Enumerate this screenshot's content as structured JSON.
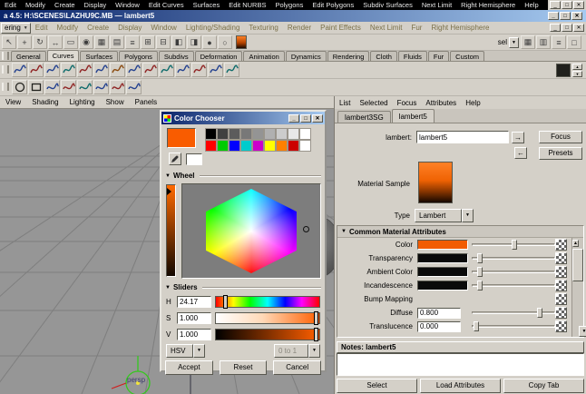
{
  "colors": {
    "accent_orange": "#f95c00",
    "titlebar_blue": "#0a246a",
    "window_gray": "#d4d0c8",
    "viewport_gray": "#969696"
  },
  "icons": {
    "minimize": "_",
    "maximize": "□",
    "close": "✕",
    "dropdown_arrow": "▼",
    "collapse_arrow": "▼",
    "spin_up": "▲",
    "spin_down": "▼",
    "connection_in": "→",
    "connection_out": "←"
  },
  "menubar_top": {
    "items": [
      "Edit",
      "Modify",
      "Create",
      "Display",
      "Window",
      "Edit Curves",
      "Surfaces",
      "Edit NURBS",
      "Polygons",
      "Edit Polygons",
      "Subdiv Surfaces",
      "Next Limit",
      "Right Hemisphere",
      "Help"
    ]
  },
  "titlebar": {
    "title": "a 4.5:  H:\\SCENES\\LAZHU9C.MB — lambert5"
  },
  "menubar2": {
    "leading": "ering",
    "items": [
      "Edit",
      "Modify",
      "Create",
      "Display",
      "Window",
      "Lighting/Shading",
      "Texturing",
      "Render",
      "Paint Effects",
      "Next Limit",
      "Fur",
      "Right Hemisphere"
    ]
  },
  "toolbar": {
    "icons_left": [
      "↖",
      "+",
      "↻",
      "↔",
      "▭",
      "◉",
      "▦",
      "▤",
      "≡",
      "⊞",
      "⊟",
      "◧",
      "◨",
      "●",
      "○"
    ],
    "sel_label": "sel",
    "icons_right": [
      "▦",
      "▥",
      "≡",
      "□"
    ]
  },
  "shelf_tabs": {
    "active": "Curves",
    "items": [
      "General",
      "Curves",
      "Surfaces",
      "Polygons",
      "Subdivs",
      "Deformation",
      "Animation",
      "Dynamics",
      "Rendering",
      "Cloth",
      "Fluids",
      "Fur",
      "Custom"
    ]
  },
  "shelf1": {
    "icon_colors": [
      "#23418f",
      "#8f2323",
      "#23418f",
      "#0e6b6b",
      "#8f2323",
      "#23418f",
      "#8a4a0e",
      "#23418f",
      "#8f2323",
      "#0e6b6b",
      "#23418f",
      "#8f2323",
      "#23418f",
      "#0e6b6b"
    ]
  },
  "shelf2": {
    "icon_colors": [
      "#23418f",
      "#8f2323",
      "#0e6b6b",
      "#23418f",
      "#8f2323",
      "#23418f"
    ]
  },
  "viewport": {
    "menus": [
      "View",
      "Shading",
      "Lighting",
      "Show",
      "Panels"
    ],
    "camera_label": "persp"
  },
  "color_chooser": {
    "title": "Color Chooser",
    "current_color": "#f95c00",
    "compare_color": "#ffffff",
    "palette_row1": [
      "#000000",
      "#404040",
      "#5c5c5c",
      "#787878",
      "#949494",
      "#b0b0b0",
      "#cccccc",
      "#e8e8e8",
      "#ffffff"
    ],
    "palette_row2": [
      "#ff0000",
      "#00cc00",
      "#0000ff",
      "#00cccc",
      "#cc00cc",
      "#ffff00",
      "#ff8000",
      "#cc0000",
      "#ffffff"
    ],
    "wheel_section": "Wheel",
    "sliders_section": "Sliders",
    "sliders": [
      {
        "label": "H",
        "value": "24.17"
      },
      {
        "label": "S",
        "value": "1.000"
      },
      {
        "label": "V",
        "value": "1.000"
      }
    ],
    "mode": "HSV",
    "range": "0 to 1",
    "accept": "Accept",
    "reset": "Reset",
    "cancel": "Cancel"
  },
  "attribute_editor": {
    "menus": [
      "List",
      "Selected",
      "Focus",
      "Attributes",
      "Help"
    ],
    "tabs": [
      "lambert3SG",
      "lambert5"
    ],
    "active_tab": "lambert5",
    "name_label": "lambert:",
    "name_value": "lambert5",
    "focus_button": "Focus",
    "presets_button": "Presets",
    "sample_label": "Material Sample",
    "type_label": "Type",
    "type_value": "Lambert",
    "section_title": "Common Material Attributes",
    "rows": [
      {
        "label": "Color",
        "swatch": "#f25c02"
      },
      {
        "label": "Transparency",
        "swatch": "#0a0a0a"
      },
      {
        "label": "Ambient Color",
        "swatch": "#0a0a0a"
      },
      {
        "label": "Incandescence",
        "swatch": "#0a0a0a"
      },
      {
        "label": "Bump Mapping"
      },
      {
        "label": "Diffuse",
        "value": "0.800"
      },
      {
        "label": "Translucence",
        "value": "0.000"
      }
    ],
    "notes_label": "Notes: lambert5",
    "buttons": [
      "Select",
      "Load Attributes",
      "Copy Tab"
    ]
  }
}
